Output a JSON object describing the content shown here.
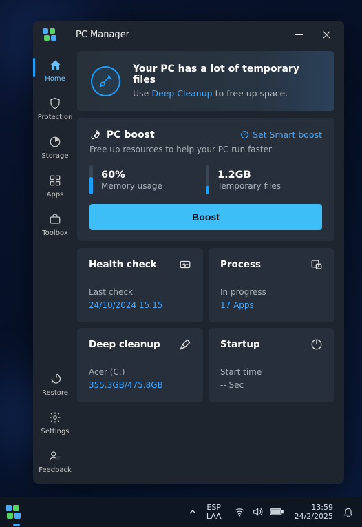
{
  "app": {
    "title": "PC Manager"
  },
  "sidebar": {
    "top": [
      {
        "id": "home",
        "label": "Home"
      },
      {
        "id": "protection",
        "label": "Protection"
      },
      {
        "id": "storage",
        "label": "Storage"
      },
      {
        "id": "apps",
        "label": "Apps"
      },
      {
        "id": "toolbox",
        "label": "Toolbox"
      }
    ],
    "bottom": [
      {
        "id": "restore",
        "label": "Restore"
      },
      {
        "id": "settings",
        "label": "Settings"
      },
      {
        "id": "feedback",
        "label": "Feedback"
      }
    ]
  },
  "banner": {
    "title": "Your PC has a lot of temporary files",
    "pre": "Use ",
    "link": "Deep Cleanup",
    "post": " to free up space."
  },
  "boost": {
    "title": "PC boost",
    "smart": "Set Smart boost",
    "sub": "Free up resources to help your PC run faster",
    "mem_val": "60%",
    "mem_lbl": "Memory usage",
    "tmp_val": "1.2GB",
    "tmp_lbl": "Temporary files",
    "button": "Boost"
  },
  "tiles": {
    "health": {
      "title": "Health check",
      "lbl": "Last check",
      "val": "24/10/2024 15:15"
    },
    "process": {
      "title": "Process",
      "lbl": "In progress",
      "val": "17 Apps"
    },
    "cleanup": {
      "title": "Deep cleanup",
      "lbl": "Acer (C:)",
      "val": "355.3GB/475.8GB"
    },
    "startup": {
      "title": "Startup",
      "lbl": "Start time",
      "val": "-- Sec"
    }
  },
  "taskbar": {
    "lang1": "ESP",
    "lang2": "LAA",
    "time": "13:59",
    "date": "24/2/2025"
  }
}
